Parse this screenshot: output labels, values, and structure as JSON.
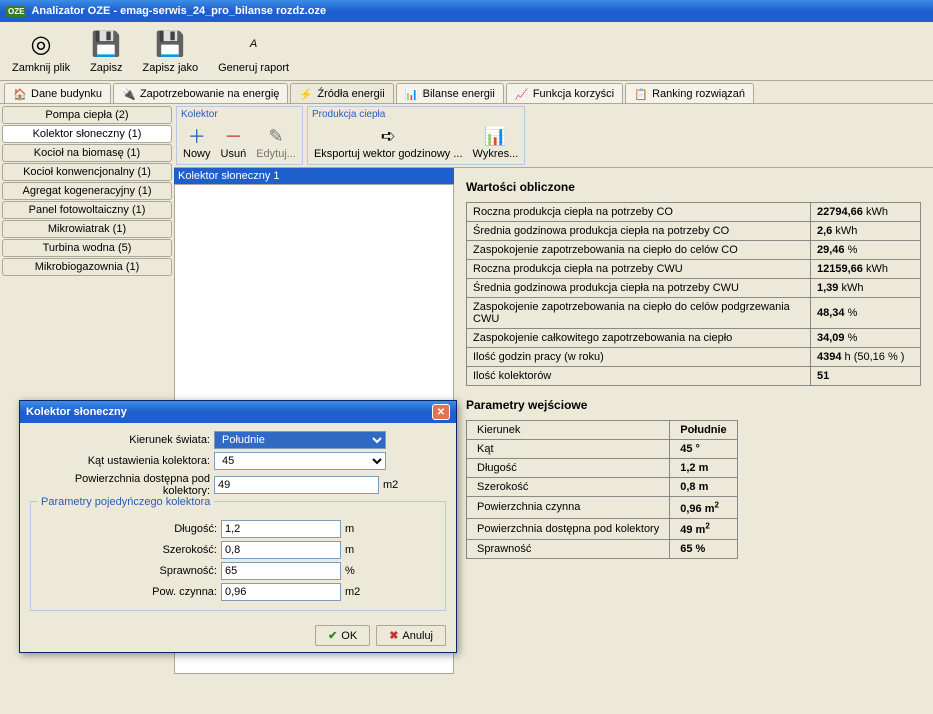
{
  "window": {
    "title": "Analizator OZE - emag-serwis_24_pro_bilanse rozdz.oze"
  },
  "toolbar": {
    "close": "Zamknij plik",
    "save": "Zapisz",
    "saveas": "Zapisz jako",
    "report": "Generuj raport"
  },
  "tabs": [
    "Dane budynku",
    "Zapotrzebowanie na energię",
    "Źródła energii",
    "Bilanse energii",
    "Funkcja korzyści",
    "Ranking rozwiązań"
  ],
  "sidebar": [
    "Pompa ciepła (2)",
    "Kolektor słoneczny (1)",
    "Kocioł na biomasę (1)",
    "Kocioł konwencjonalny (1)",
    "Agregat kogeneracyjny (1)",
    "Panel fotowoltaiczny (1)",
    "Mikrowiatrak (1)",
    "Turbina wodna (5)",
    "Mikrobiogazownia (1)"
  ],
  "ribbon": {
    "g1": {
      "title": "Kolektor",
      "new": "Nowy",
      "del": "Usuń",
      "edit": "Edytuj..."
    },
    "g2": {
      "title": "Produkcja ciepła",
      "export": "Eksportuj wektor godzinowy ...",
      "chart": "Wykres..."
    }
  },
  "list": {
    "header": "Kolektor słoneczny 1"
  },
  "calc": {
    "title": "Wartości obliczone",
    "rows": [
      {
        "k": "Roczna produkcja ciepła na potrzeby CO",
        "v": "22794,66",
        "u": " kWh"
      },
      {
        "k": "Średnia godzinowa produkcja ciepła na potrzeby CO",
        "v": "2,6",
        "u": " kWh"
      },
      {
        "k": "Zaspokojenie zapotrzebowania na ciepło do celów CO",
        "v": "29,46",
        "u": " %"
      },
      {
        "k": "Roczna produkcja ciepła na potrzeby CWU",
        "v": "12159,66",
        "u": " kWh"
      },
      {
        "k": "Średnia godzinowa produkcja ciepła na potrzeby CWU",
        "v": "1,39",
        "u": " kWh"
      },
      {
        "k": "Zaspokojenie zapotrzebowania na ciepło do celów podgrzewania CWU",
        "v": "48,34",
        "u": " %"
      },
      {
        "k": "Zaspokojenie całkowitego zapotrzebowania na ciepło",
        "v": "34,09",
        "u": " %"
      },
      {
        "k": "Ilość godzin pracy (w roku)",
        "v": "4394",
        "u": " h (50,16 % )"
      },
      {
        "k": "Ilość kolektorów",
        "v": "51",
        "u": ""
      }
    ]
  },
  "params": {
    "title": "Parametry wejściowe",
    "rows": [
      {
        "k": "Kierunek",
        "v": "Południe",
        "sup": ""
      },
      {
        "k": "Kąt",
        "v": "45 °",
        "sup": ""
      },
      {
        "k": "Długość",
        "v": "1,2 m",
        "sup": ""
      },
      {
        "k": "Szerokość",
        "v": "0,8 m",
        "sup": ""
      },
      {
        "k": "Powierzchnia czynna",
        "v": "0,96 m",
        "sup": "2"
      },
      {
        "k": "Powierzchnia dostępna pod kolektory",
        "v": "49 m",
        "sup": "2"
      },
      {
        "k": "Sprawność",
        "v": "65 %",
        "sup": ""
      }
    ]
  },
  "dialog": {
    "title": "Kolektor słoneczny",
    "f1": {
      "label": "Kierunek świata:",
      "value": "Południe"
    },
    "f2": {
      "label": "Kąt ustawienia kolektora:",
      "value": "45"
    },
    "f3": {
      "label": "Powierzchnia dostępna pod kolektory:",
      "value": "49",
      "unit": "m2"
    },
    "fs": {
      "legend": "Parametry pojedyńczego kolektora",
      "len": {
        "label": "Długość:",
        "value": "1,2",
        "unit": "m"
      },
      "wid": {
        "label": "Szerokość:",
        "value": "0,8",
        "unit": "m"
      },
      "eff": {
        "label": "Sprawność:",
        "value": "65",
        "unit": "%"
      },
      "area": {
        "label": "Pow. czynna:",
        "value": "0,96",
        "unit": "m2"
      }
    },
    "ok": "OK",
    "cancel": "Anuluj"
  }
}
